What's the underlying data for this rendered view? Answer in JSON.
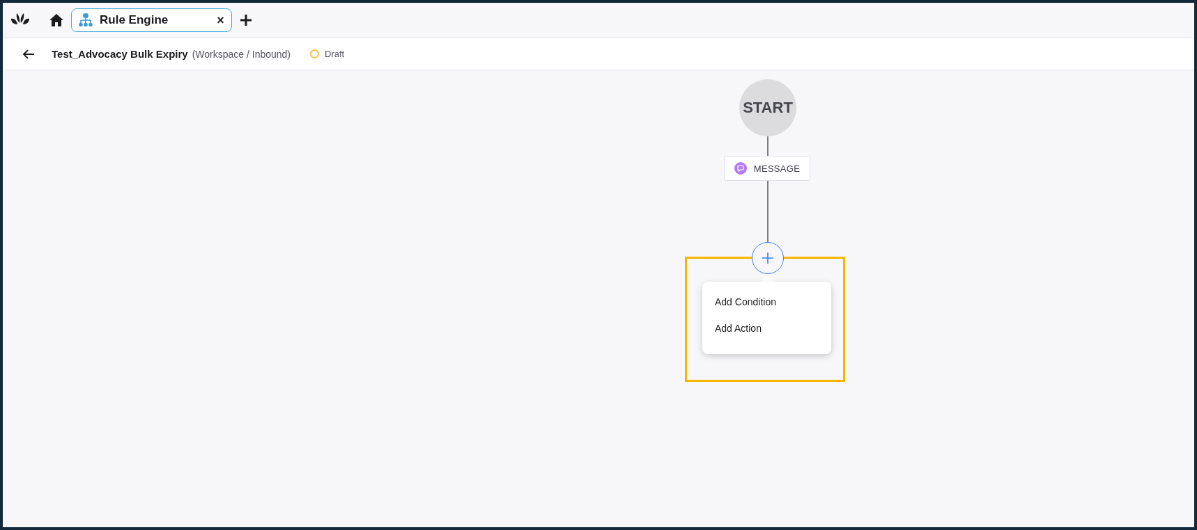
{
  "tabs": [
    {
      "label": "Rule Engine",
      "selected": true,
      "close": "×"
    }
  ],
  "header": {
    "title": "Test_Advocacy Bulk Expiry",
    "context": "(Workspace / Inbound)",
    "status": {
      "label": "Draft",
      "color": "#f5c242"
    }
  },
  "flow": {
    "start": "START",
    "nodes": [
      {
        "kind": "message",
        "label": "MESSAGE"
      }
    ],
    "add_menu": {
      "open": true,
      "items": [
        {
          "label": "Add Condition"
        },
        {
          "label": "Add Action"
        }
      ]
    },
    "highlight": true
  }
}
